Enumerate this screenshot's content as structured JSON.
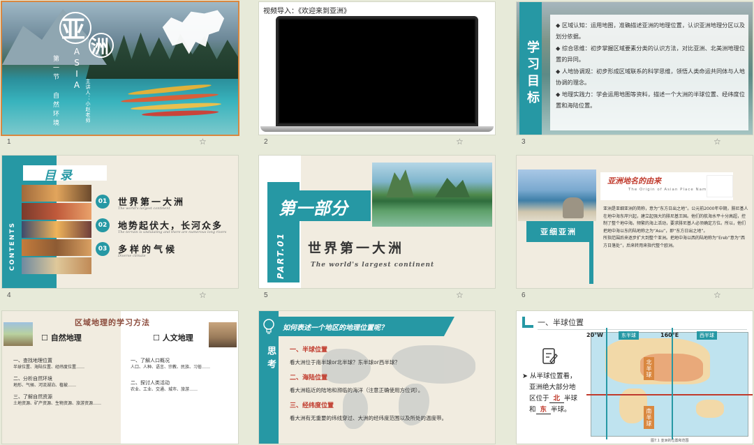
{
  "slides": [
    {
      "num": "1",
      "title_big1": "亚",
      "title_big2": "洲",
      "title_en": "ASIA",
      "section": "第一节 自然环境",
      "speaker": "主讲人：小赵老师"
    },
    {
      "num": "2",
      "video_label": "视频导入：《欢迎来到亚洲》"
    },
    {
      "num": "3",
      "heading": "学习目标",
      "bullets": [
        "区域认知：运用地图，准确描述亚洲的地理位置，认识亚洲地理分区以及划分依据。",
        "综合思维：初步掌握区域要素分类的认识方法，对比亚洲、北美洲地理位置的异同。",
        "人地协调观：初步形成区域联系的科学思维，领悟人类命运共同体与人地协调的理念。",
        "地理实践力：学会运用地图等资料，描述一个大洲的半球位置、经纬度位置和海陆位置。"
      ]
    },
    {
      "num": "4",
      "title": "目 录",
      "side": "CONTENTS",
      "items": [
        {
          "n": "01",
          "cn": "世界第一大洲",
          "en": "The world's largest continent"
        },
        {
          "n": "02",
          "cn": "地势起伏大，长河众多",
          "en": "The terrain is undulating and there are numerous long rivers"
        },
        {
          "n": "03",
          "cn": "多样的气候",
          "en": "Diverse climate"
        }
      ]
    },
    {
      "num": "5",
      "part": "第一部分",
      "part_en": "PART.01",
      "title": "世界第一大洲",
      "subtitle": "The world's largest continent"
    },
    {
      "num": "6",
      "heading": "亚洲地名的由来",
      "heading_en": "The Origin of Asian Place Names",
      "side_label": "亚细亚洲",
      "p1": "亚洲是亚细亚洲的简称，意为“东方日出之地”。公元前2000年中期，腓尼基人在地中海东岸兴起，建立起强大的腓尼基王国。他们的航海水平十分高超，控制了整个地中海。频繁的海上活动，要求腓尼基人必须确定方位。所以，他们把地中海以东的陆地称之为“Asu”，即“东方日出之地”。",
      "p2": "所指范围后来逐步扩大到整个亚洲。把地中海以西的陆地称为“Ereb”意为“西方日落处”，后来转用来指代整个欧洲。",
      "hl1": "亚细亚洲",
      "hl2": "东方日出之地"
    },
    {
      "num": "7",
      "title": "区域地理的学习方法",
      "left_h": "自然地理",
      "right_h": "人文地理",
      "left": [
        {
          "h": "一、查找地理位置",
          "t": "半球位置、海陆位置、经纬度位置……"
        },
        {
          "h": "二、分析自然环境",
          "t": "地形、气候、河流湖泊、植被……"
        },
        {
          "h": "三、了解自然资源",
          "t": "土地资源、矿产资源、生物资源、旅游资源……"
        }
      ],
      "right": [
        {
          "h": "一、了解人口概况",
          "t": "人口、人种、语言、宗教、民族、习俗……"
        },
        {
          "h": "二、探讨人类活动",
          "t": "农业、工业、交通、城市、旅游……"
        }
      ]
    },
    {
      "num": "8",
      "side": "思考",
      "banner": "如何表述一个地区的地理位置呢？",
      "sections": [
        {
          "h": "一、半球位置",
          "t": "看大洲位于南半球or北半球？东半球or西半球？"
        },
        {
          "h": "二、海陆位置",
          "t": "看大洲临近的陆地和濒临的海洋（注意正确使用方位词）。"
        },
        {
          "h": "三、经纬度位置",
          "t": "看大洲有无重要的纬线穿过、大洲的经纬度范围以及所处的温度带。"
        }
      ]
    },
    {
      "num": "9",
      "title": "一、半球位置",
      "q1": "从半球位置看，",
      "q2": "亚洲绝大部分地",
      "q3": "区位于",
      "a1": "北",
      "q4": "半球",
      "q5": "和",
      "a2": "东",
      "q6": "半球。",
      "lon1": "20°W",
      "east": "东半球",
      "lon2": "160°E",
      "west": "西半球",
      "north": "北半球",
      "south": "南半球",
      "caption": "图7.1 亚洲的位置和范围"
    }
  ],
  "colors": {
    "teal": "#2698a4",
    "accent": "#d9873f",
    "red": "#c0392b",
    "paper": "#f1ece0"
  }
}
